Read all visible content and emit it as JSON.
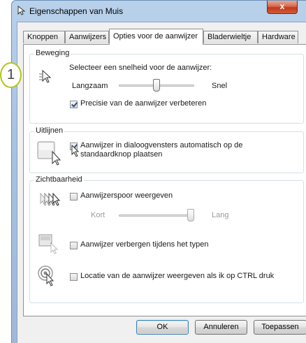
{
  "window": {
    "title": "Eigenschappen van Muis",
    "close_label": "x"
  },
  "tabs": [
    {
      "label": "Knoppen"
    },
    {
      "label": "Aanwijzers"
    },
    {
      "label": "Opties voor de aanwijzer",
      "active": true
    },
    {
      "label": "Bladerwieltje"
    },
    {
      "label": "Hardware"
    }
  ],
  "motion": {
    "title": "Beweging",
    "prompt": "Selecteer een snelheid voor de aanwijzer:",
    "slow_label": "Langzaam",
    "fast_label": "Snel",
    "speed_fraction": 0.5,
    "precision_label": "Precisie van de aanwijzer verbeteren",
    "precision_checked": true
  },
  "snap_to": {
    "title": "Uitlijnen",
    "label": "Aanwijzer in dialoogvensters automatisch op de standaardknop plaatsen",
    "checked": true
  },
  "visibility": {
    "title": "Zichtbaarheid",
    "trails_label": "Aanwijzerspoor weergeven",
    "trails_checked": false,
    "short_label": "Kort",
    "long_label": "Lang",
    "trail_fraction": 1.0,
    "hide_label": "Aanwijzer verbergen tijdens het typen",
    "hide_checked": false,
    "ctrl_label": "Locatie van de aanwijzer weergeven als ik op CTRL druk",
    "ctrl_checked": false
  },
  "buttons": {
    "ok": "OK",
    "cancel": "Annuleren",
    "apply": "Toepassen"
  },
  "annotation": {
    "number": "1"
  },
  "colors": {
    "accent_marker": "#b6c51a",
    "close_button": "#c03a1b",
    "frame": "#a8c3e2"
  }
}
